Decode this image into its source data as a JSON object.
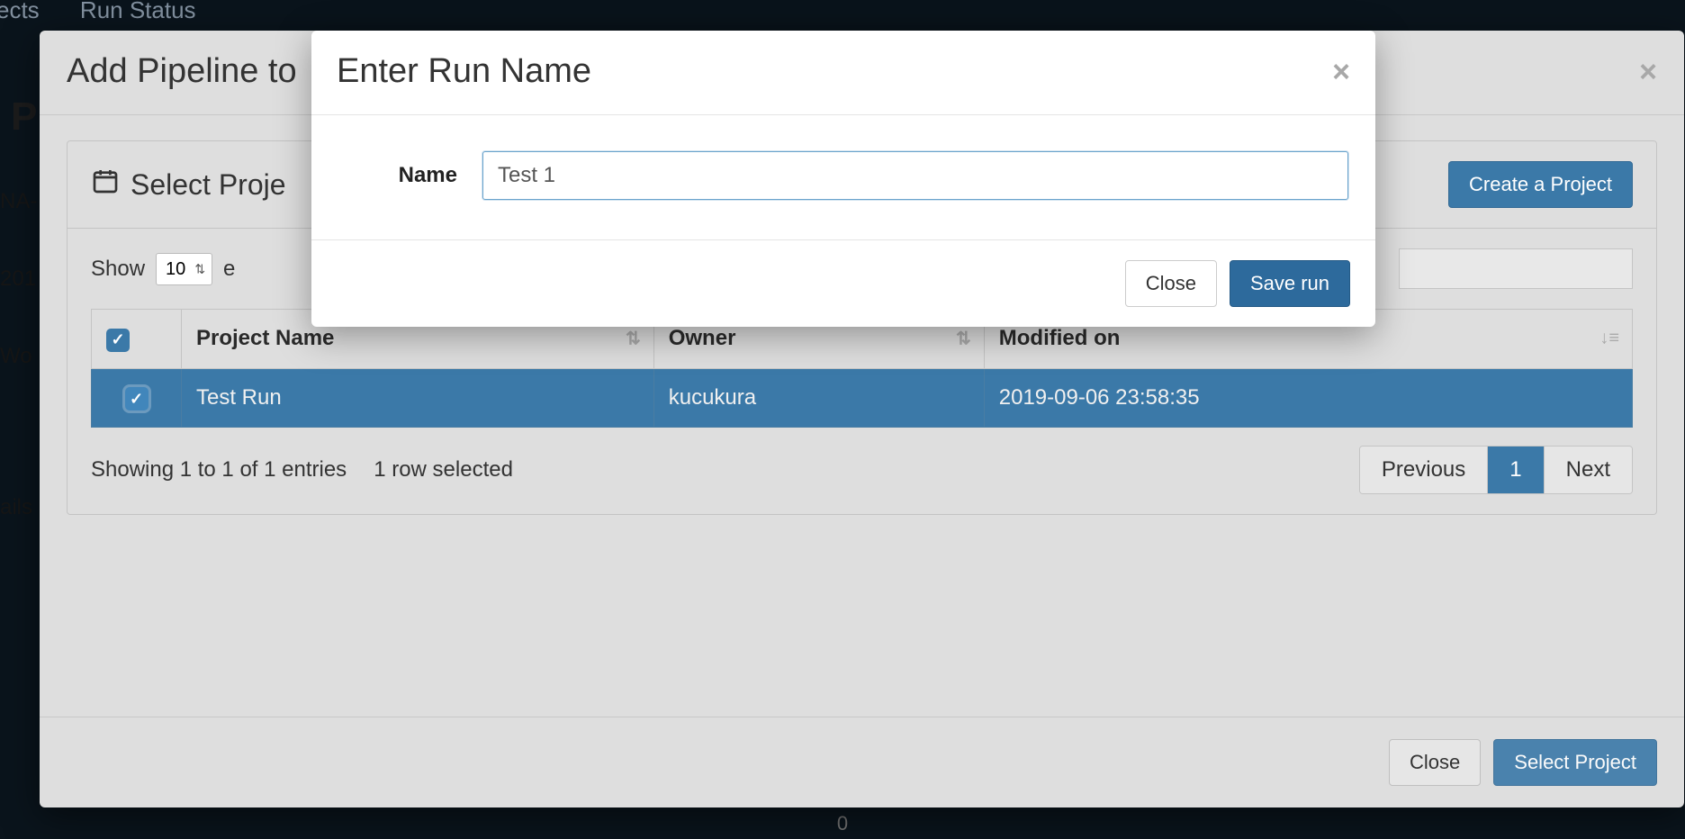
{
  "background": {
    "nav": [
      "ects",
      "Run Status"
    ],
    "side": [
      "NA-",
      "201",
      "Wo",
      "ails"
    ],
    "page_p": "P",
    "bottom_zero": "0"
  },
  "outerModal": {
    "title": "Add Pipeline to",
    "panel": {
      "title": "Select Proje",
      "createButton": "Create a Project"
    },
    "table": {
      "showLabel": "Show",
      "showValue": "10",
      "entriesPrefix": "e",
      "columns": {
        "name": "Project Name",
        "owner": "Owner",
        "modified": "Modified on"
      },
      "rows": [
        {
          "name": "Test Run",
          "owner": "kucukura",
          "modified": "2019-09-06 23:58:35",
          "selected": true
        }
      ],
      "info": "Showing 1 to 1 of 1 entries",
      "selectedInfo": "1 row selected",
      "prev": "Previous",
      "page": "1",
      "next": "Next"
    },
    "footer": {
      "close": "Close",
      "select": "Select Project"
    }
  },
  "innerModal": {
    "title": "Enter Run Name",
    "nameLabel": "Name",
    "nameValue": "Test 1",
    "close": "Close",
    "save": "Save run"
  }
}
